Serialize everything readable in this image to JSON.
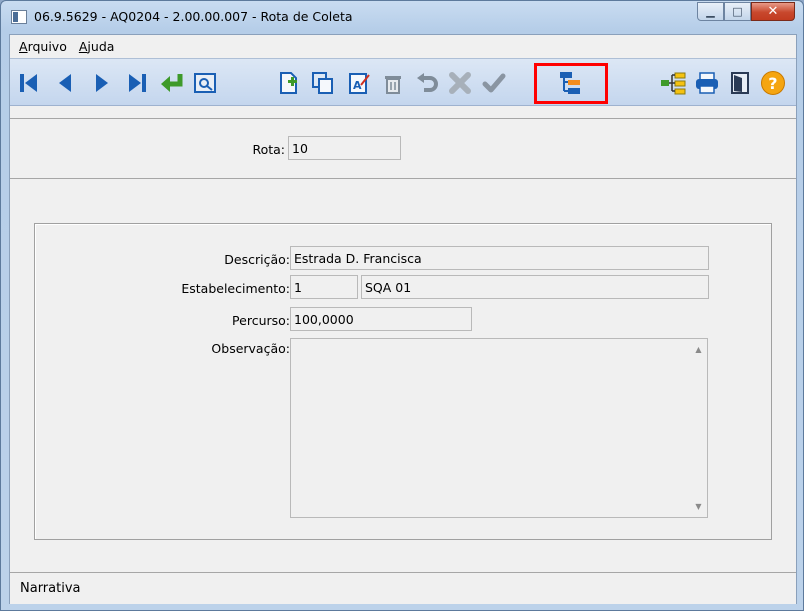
{
  "window": {
    "title": "06.9.5629 - AQ0204 - 2.00.00.007 - Rota de Coleta",
    "minimize_label": "▁",
    "maximize_label": "□",
    "close_label": "✕"
  },
  "menu": {
    "file_first": "A",
    "file_rest": "rquivo",
    "help_first": "A",
    "help_rest": "juda"
  },
  "toolbar": {
    "icons": [
      "first-record-icon",
      "previous-record-icon",
      "next-record-icon",
      "last-record-icon",
      "goto-record-icon",
      "search-icon",
      "new-record-icon",
      "copy-record-icon",
      "edit-record-icon",
      "delete-record-icon",
      "undo-icon",
      "cancel-icon",
      "save-icon",
      "tree-structure-icon",
      "hierarchy-icon",
      "print-icon",
      "exit-icon",
      "help-icon"
    ],
    "colors": {
      "navy": "#1a5fb4",
      "green": "#3e9a2a",
      "gray": "#7f8c99",
      "yellow": "#f5c211",
      "orange": "#f28c1e"
    }
  },
  "form": {
    "rota_label": "Rota:",
    "rota_value": "10",
    "descricao_label": "Descrição:",
    "descricao_value": "Estrada D. Francisca",
    "estabelecimento_label": "Estabelecimento:",
    "estabelecimento_code": "1",
    "estabelecimento_name": "SQA 01",
    "percurso_label": "Percurso:",
    "percurso_value": "100,0000",
    "observacao_label": "Observação:",
    "observacao_value": ""
  },
  "status": {
    "text": "Narrativa"
  }
}
